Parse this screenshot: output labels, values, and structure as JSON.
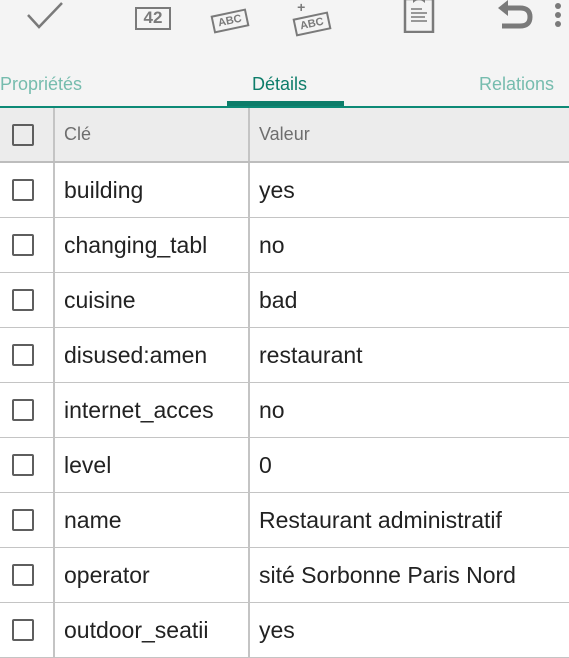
{
  "toolbar": {
    "buttons": [
      {
        "name": "confirm",
        "icon": "check-icon"
      },
      {
        "name": "numeric-value",
        "icon": "number-42-icon",
        "label": "42"
      },
      {
        "name": "tag-text",
        "icon": "abc-tag-icon",
        "label": "ABC"
      },
      {
        "name": "add-tag",
        "icon": "add-abc-tag-icon",
        "label": "ABC"
      },
      {
        "name": "paste",
        "icon": "clipboard-icon"
      },
      {
        "name": "undo",
        "icon": "undo-icon"
      },
      {
        "name": "more",
        "icon": "more-vert-icon"
      }
    ]
  },
  "tabs": [
    {
      "label": "Propriétés",
      "active": false
    },
    {
      "label": "Détails",
      "active": true
    },
    {
      "label": "Relations",
      "active": false
    }
  ],
  "colors": {
    "accent": "#0d7d6a",
    "tab_inactive": "#76bcae",
    "background": "#f4f4f4",
    "header_bg": "#ececec",
    "row_bg": "#ffffff",
    "divider": "#c4c4c4"
  },
  "table": {
    "columns": {
      "key": "Clé",
      "value": "Valeur"
    },
    "rows": [
      {
        "key": "building",
        "value": "yes",
        "checked": false
      },
      {
        "key": "changing_tabl",
        "value": "no",
        "checked": false
      },
      {
        "key": "cuisine",
        "value": "bad",
        "checked": false
      },
      {
        "key": "disused:amen",
        "value": "restaurant",
        "checked": false
      },
      {
        "key": "internet_acces",
        "value": "no",
        "checked": false
      },
      {
        "key": "level",
        "value": "0",
        "checked": false
      },
      {
        "key": "name",
        "value": "Restaurant administratif",
        "checked": false
      },
      {
        "key": "operator",
        "value": "sité Sorbonne Paris Nord",
        "checked": false
      },
      {
        "key": "outdoor_seatii",
        "value": "yes",
        "checked": false
      }
    ]
  }
}
